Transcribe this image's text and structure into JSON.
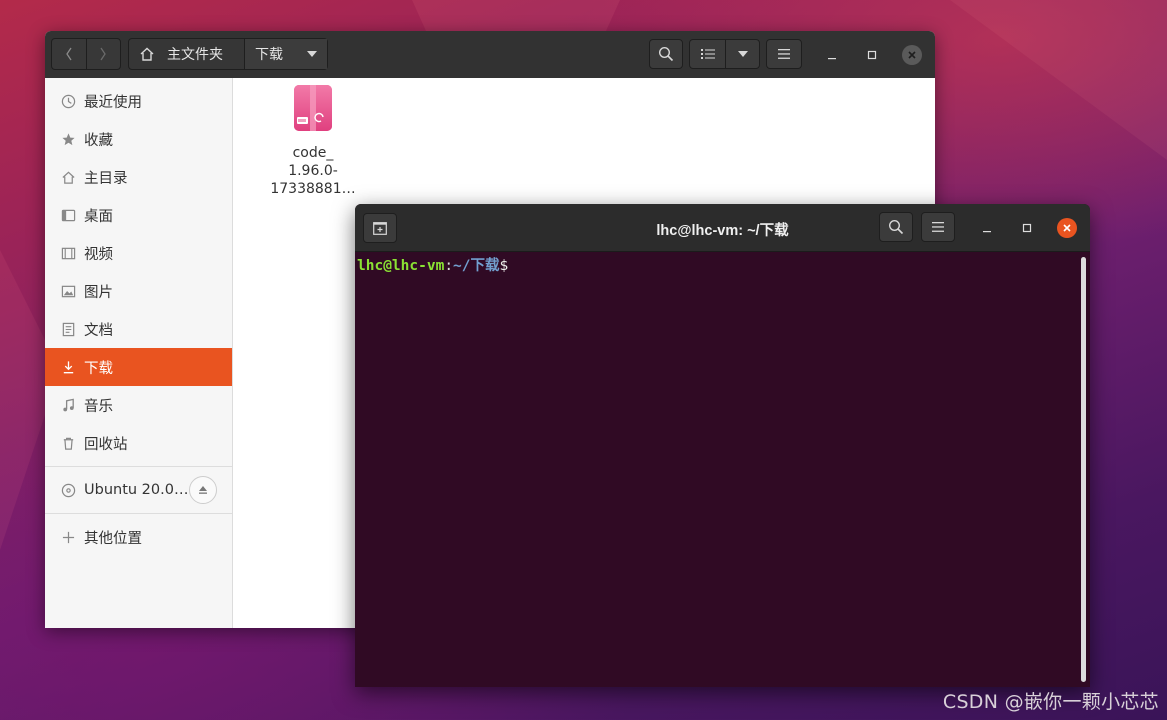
{
  "file_manager": {
    "breadcrumb": {
      "home_label": "主文件夹",
      "current_label": "下载"
    },
    "sidebar": {
      "items": [
        {
          "label": "最近使用",
          "icon": "clock-icon"
        },
        {
          "label": "收藏",
          "icon": "star-icon"
        },
        {
          "label": "主目录",
          "icon": "home-icon"
        },
        {
          "label": "桌面",
          "icon": "desktop-icon"
        },
        {
          "label": "视频",
          "icon": "film-icon"
        },
        {
          "label": "图片",
          "icon": "picture-icon"
        },
        {
          "label": "文档",
          "icon": "document-icon"
        },
        {
          "label": "下载",
          "icon": "download-icon",
          "active": true
        },
        {
          "label": "音乐",
          "icon": "music-icon"
        },
        {
          "label": "回收站",
          "icon": "trash-icon"
        }
      ],
      "drive_label": "Ubuntu 20.0…",
      "other_locations_label": "其他位置"
    },
    "files": [
      {
        "name_lines": [
          "code_",
          "1.96.0-",
          "17338881…"
        ],
        "icon": "debian-package-icon"
      }
    ]
  },
  "terminal": {
    "title": "lhc@lhc-vm: ~/下载",
    "prompt": {
      "user_host": "lhc@lhc-vm",
      "colon": ":",
      "path": "~/下载",
      "symbol": "$"
    }
  },
  "watermark": "CSDN @嵌你一颗小芯芯",
  "colors": {
    "accent": "#e95420",
    "terminal_bg": "#300a24",
    "header_bg": "#323232"
  }
}
